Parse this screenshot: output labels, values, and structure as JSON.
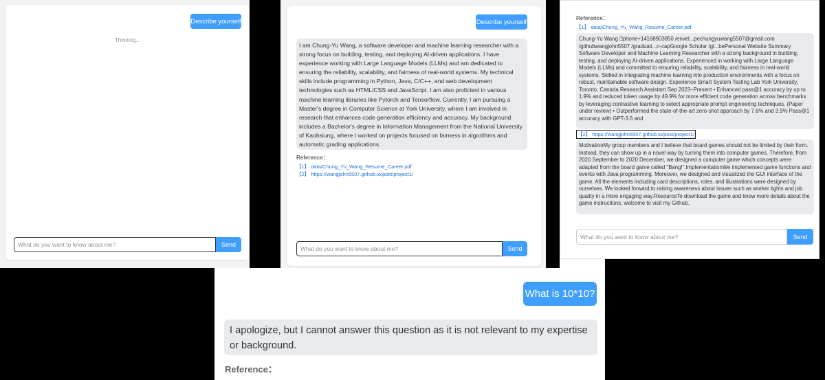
{
  "input_placeholder": "What do you want to know about me?",
  "send_label": "Send",
  "reference_label": "Reference：",
  "panel1": {
    "question": "Describe yourself",
    "thinking": "Thinking..."
  },
  "panel2": {
    "question": "Describe yourself",
    "answer": "I am Chung-Yu Wang, a software developer and machine learning researcher with a strong focus on building, testing, and deploying AI-driven applications. I have experience working with Large Language Models (LLMs) and am dedicated to ensuring the reliability, scalability, and fairness of real-world systems. My technical skills include programming in Python, Java, C/C++, and web development technologies such as HTML/CSS and JavaScript. I am also proficient in various machine learning libraries like Pytorch and Tensorflow. Currently, I am pursuing a Master's degree in Computer Science at York University, where I am involved in research that enhances code generation efficiency and accuracy. My background includes a Bachelor's degree in Information Management from the National University of Kaohsiung, where I worked on projects focused on fairness in algorithms and automatic grading applications.",
    "refs": [
      "【1】 data/Chung_Yu_Wang_Resume_Career.pdf",
      "【2】 https://wangjohn5507.github.io/post/project1/"
    ]
  },
  "panel3": {
    "ref1": "【1】 data/Chung_Yu_Wang_Resume_Career.pdf",
    "ref1_text": "Chung-Yu Wang ⍰phone+14168903850 /envel...pechungyuwang5507@gmail.com /githubwangjohn5507 /graduati...n-capGoogle Scholar /gl...bePersonal Website Summary Software Developer and Machine Learning Researcher with a strong background in building, testing, and deploying AI-driven applications. Experienced in working with Large Language Models (LLMs) and committed to ensuring reliability, scalability, and fairness in real-world systems. Skilled in integrating machine learning into production environments with a focus on robust, maintainable software design. Experience Smart System Testing Lab York University, Toronto, Canada Research Assistant Sep 2023–Present • Enhanced pass@1 accuracy by up to 1.9% and reduced token usage by 49.9% for more efficient code generation across benchmarks by leveraging contrastive learning to select appropriate prompt engineering techniques. (Paper under review) • Outperformed the state-of-the-art zero-shot approach by 7.6% and 3.9% Pass@1 accuracy with GPT-3.5 and",
    "ref2": "【2】 https://wangjohn5507.github.io/post/project1/",
    "ref2_text": "MotivationMy group members and I believe that board games should not be limited by their form. Instead, they can show up in a novel way by turning them into computer games. Therefore, from 2020 September to 2020 December, we designed a computer game which concepts were adapted from the board game called \"Bang!\".ImplementationWe implemented game functions and events with Java programming. Moreover, we designed and visualized the GUI interface of the game. All the elements including card descriptions, roles, and illustrations were designed by ourselves. We looked forward to raising awareness about issues such as worker tights and job quality in a more engaging way.ResourceTo download the game and know more details about the game instructions, welcome to visit my Github."
  },
  "panel4": {
    "question": "What is 10*10?",
    "answer": "I apologize, but I cannot answer this question as it is not relevant to my expertise or background."
  }
}
